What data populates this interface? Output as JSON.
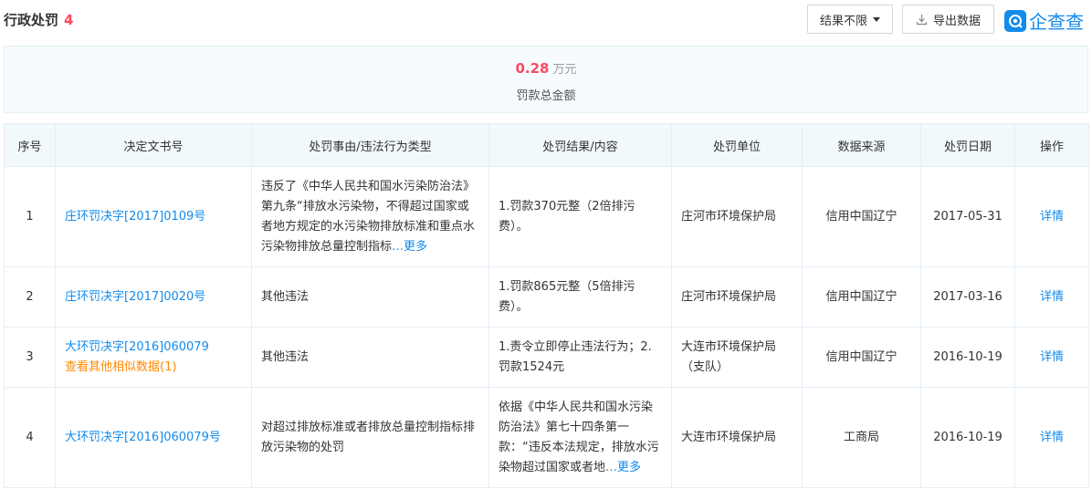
{
  "header": {
    "title": "行政处罚",
    "count": "4",
    "filter_label": "结果不限",
    "export_label": "导出数据",
    "logo_text": "企查查"
  },
  "summary": {
    "amount": "0.28",
    "unit": "万元",
    "label": "罚款总金额"
  },
  "table": {
    "columns": [
      "序号",
      "决定文书号",
      "处罚事由/违法行为类型",
      "处罚结果/内容",
      "处罚单位",
      "数据来源",
      "处罚日期",
      "操作"
    ],
    "rows": [
      {
        "index": "1",
        "doc_no": "庄环罚决字[2017]0109号",
        "similar": "",
        "reason": "违反了《中华人民共和国水污染防治法》第九条“排放水污染物，不得超过国家或者地方规定的水污染物排放标准和重点水污染物排放总量控制指标",
        "reason_more": "…更多",
        "result": "1.罚款370元整（2倍排污费）。",
        "result_more": "",
        "unit": "庄河市环境保护局",
        "source": "信用中国辽宁",
        "date": "2017-05-31",
        "action": "详情"
      },
      {
        "index": "2",
        "doc_no": "庄环罚决字[2017]0020号",
        "similar": "",
        "reason": "其他违法",
        "reason_more": "",
        "result": "1.罚款865元整（5倍排污费）。",
        "result_more": "",
        "unit": "庄河市环境保护局",
        "source": "信用中国辽宁",
        "date": "2017-03-16",
        "action": "详情"
      },
      {
        "index": "3",
        "doc_no": "大环罚决字[2016]060079",
        "similar": "查看其他相似数据(1)",
        "reason": "其他违法",
        "reason_more": "",
        "result": "1.责令立即停止违法行为；2.罚款1524元",
        "result_more": "",
        "unit": "大连市环境保护局（支队）",
        "source": "信用中国辽宁",
        "date": "2016-10-19",
        "action": "详情"
      },
      {
        "index": "4",
        "doc_no": "大环罚决字[2016]060079号",
        "similar": "",
        "reason": "对超过排放标准或者排放总量控制指标排放污染物的处罚",
        "reason_more": "",
        "result": "依据《中华人民共和国水污染防治法》第七十四条第一款：“违反本法规定，排放水污染物超过国家或者地",
        "result_more": "…更多",
        "unit": "大连市环境保护局",
        "source": "工商局",
        "date": "2016-10-19",
        "action": "详情"
      }
    ]
  },
  "colors": {
    "accent_blue": "#128bed",
    "count_red": "#fd485e",
    "similar_orange": "#ff8900",
    "header_bg": "#f2f9fc"
  },
  "icons": {
    "caret": "caret-down-icon",
    "export": "download-icon",
    "logo": "qichacha-logo-icon"
  }
}
